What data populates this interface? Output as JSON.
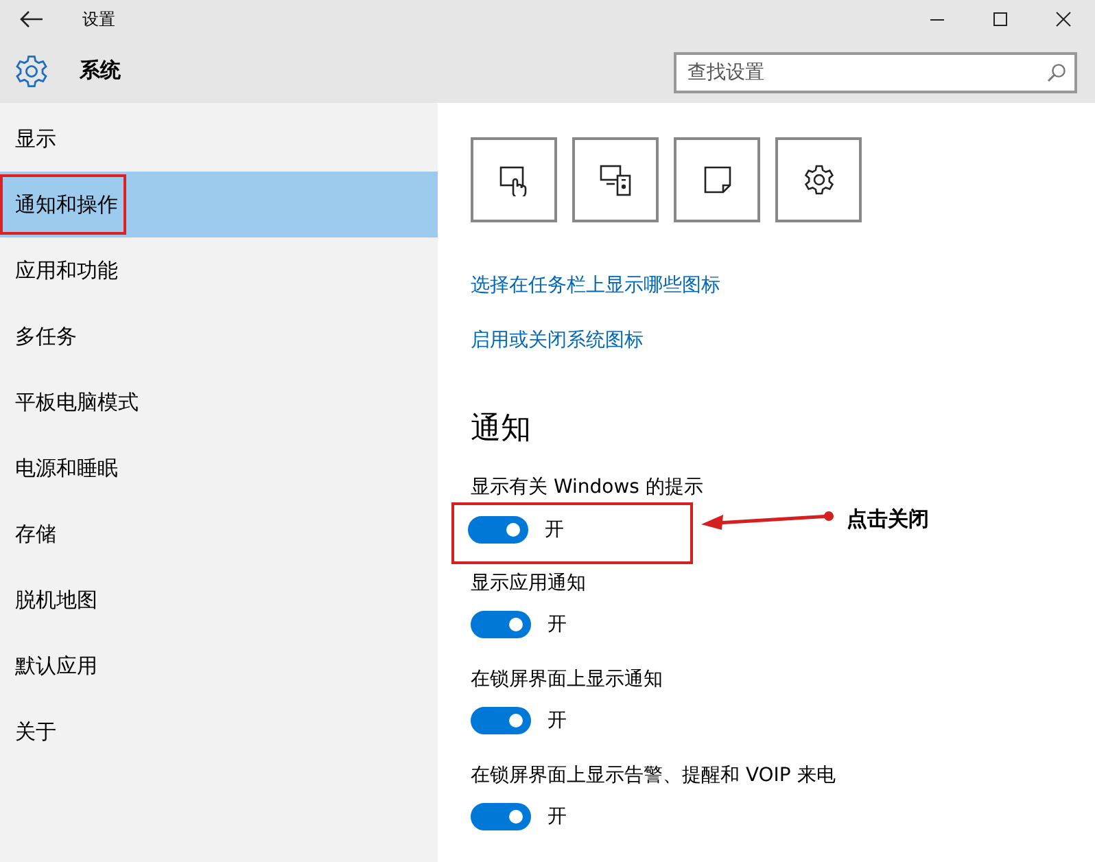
{
  "window": {
    "title": "设置"
  },
  "header": {
    "section": "系统",
    "search": {
      "placeholder": "查找设置"
    }
  },
  "sidebar": {
    "items": [
      {
        "label": "显示",
        "selected": false,
        "annotated": false
      },
      {
        "label": "通知和操作",
        "selected": true,
        "annotated": true
      },
      {
        "label": "应用和功能",
        "selected": false,
        "annotated": false
      },
      {
        "label": "多任务",
        "selected": false,
        "annotated": false
      },
      {
        "label": "平板电脑模式",
        "selected": false,
        "annotated": false
      },
      {
        "label": "电源和睡眠",
        "selected": false,
        "annotated": false
      },
      {
        "label": "存储",
        "selected": false,
        "annotated": false
      },
      {
        "label": "脱机地图",
        "selected": false,
        "annotated": false
      },
      {
        "label": "默认应用",
        "selected": false,
        "annotated": false
      },
      {
        "label": "关于",
        "selected": false,
        "annotated": false
      }
    ]
  },
  "quick_actions": [
    {
      "kind": "tablet"
    },
    {
      "kind": "connect"
    },
    {
      "kind": "note"
    },
    {
      "kind": "settings"
    }
  ],
  "links": [
    "选择在任务栏上显示哪些图标",
    "启用或关闭系统图标"
  ],
  "section_heading": "通知",
  "settings": [
    {
      "label": "显示有关 Windows 的提示",
      "on": true,
      "state_label": "开",
      "annotated": true
    },
    {
      "label": "显示应用通知",
      "on": true,
      "state_label": "开",
      "annotated": false
    },
    {
      "label": "在锁屏界面上显示通知",
      "on": true,
      "state_label": "开",
      "annotated": false
    },
    {
      "label": "在锁屏界面上显示告警、提醒和 VOIP 来电",
      "on": true,
      "state_label": "开",
      "annotated": false
    }
  ],
  "callout": {
    "text": "点击关闭"
  }
}
